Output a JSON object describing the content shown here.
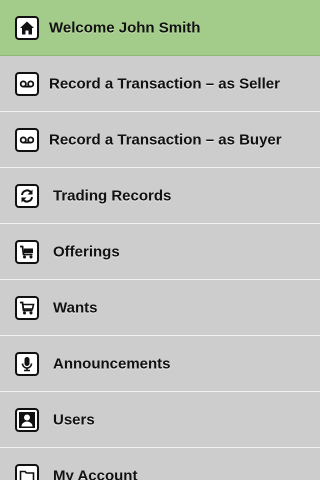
{
  "menu": {
    "items": [
      {
        "label": "Welcome John Smith",
        "icon": "home-icon",
        "active": true
      },
      {
        "label": "Record a Transaction – as Seller",
        "icon": "voicemail-icon"
      },
      {
        "label": "Record a Transaction – as Buyer",
        "icon": "voicemail-icon"
      },
      {
        "label": "Trading Records",
        "icon": "refresh-icon"
      },
      {
        "label": "Offerings",
        "icon": "cart-icon"
      },
      {
        "label": "Wants",
        "icon": "shopping-cart-icon"
      },
      {
        "label": "Announcements",
        "icon": "microphone-icon"
      },
      {
        "label": "Users",
        "icon": "user-icon"
      },
      {
        "label": "My Account",
        "icon": "folder-icon"
      }
    ]
  },
  "colors": {
    "active_background": "#a3cc8a",
    "item_background": "#cdcdcd",
    "separator": "#f2f2f2",
    "text": "#111111"
  }
}
